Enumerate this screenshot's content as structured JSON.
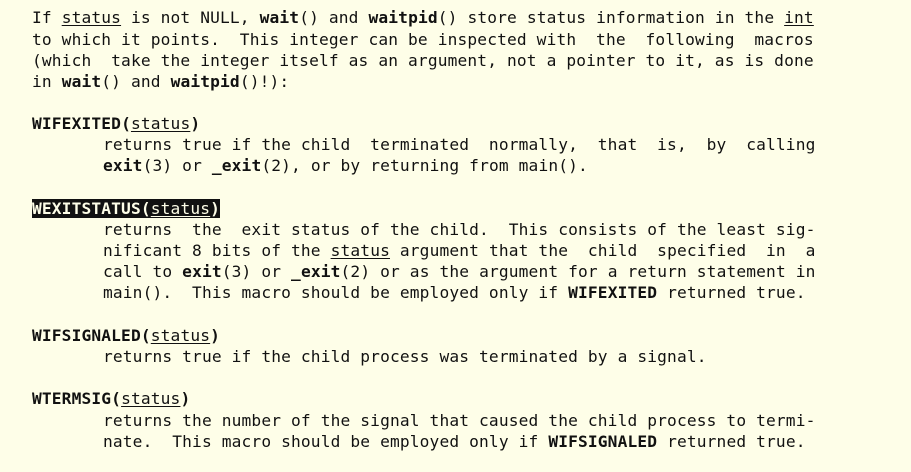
{
  "intro": {
    "l1": {
      "a": "If ",
      "status": "status",
      "b": " is not NULL, ",
      "wait": "wait",
      "c": "() and ",
      "waitpid": "waitpid",
      "d": "() store status information in the ",
      "int": "int"
    },
    "l2": "to which it points.  This integer can be inspected with  the  following  macros",
    "l3": "(which  take the integer itself as an argument, not a pointer to it, as is done",
    "l4": {
      "a": "in ",
      "wait": "wait",
      "b": "() and ",
      "waitpid": "waitpid",
      "c": "()!):"
    }
  },
  "wifexited": {
    "name": "WIFEXITED",
    "open": "(",
    "arg": "status",
    "close": ")",
    "d1": "returns true if the child  terminated  normally,  that  is,  by  calling",
    "d2": {
      "exit": "exit",
      "a": "(3) or ",
      "_exit": "_exit",
      "b": "(2), or by returning from main()."
    }
  },
  "wexitstatus": {
    "name": "WEXITSTATUS",
    "open": "(",
    "arg": "status",
    "close": ")",
    "d1": "returns  the  exit status of the child.  This consists of the least sig-",
    "d2": {
      "a": "nificant 8 bits of the ",
      "status": "status",
      "b": " argument that the  child  specified  in  a"
    },
    "d3": {
      "a": "call to ",
      "exit": "exit",
      "b": "(3) or ",
      "_exit": "_exit",
      "c": "(2) or as the argument for a return statement in"
    },
    "d4": {
      "a": "main().  This macro should be employed only if ",
      "wifexited": "WIFEXITED",
      "b": " returned true."
    }
  },
  "wifsignaled": {
    "name": "WIFSIGNALED",
    "open": "(",
    "arg": "status",
    "close": ")",
    "d1": "returns true if the child process was terminated by a signal."
  },
  "wtermsig": {
    "name": "WTERMSIG",
    "open": "(",
    "arg": "status",
    "close": ")",
    "d1": "returns the number of the signal that caused the child process to termi-",
    "d2": {
      "a": "nate.  This macro should be employed only if ",
      "wifsignaled": "WIFSIGNALED",
      "b": " returned true."
    }
  },
  "colors": {
    "background": "#fefee8",
    "text": "#111111",
    "highlight_bg": "#111111",
    "highlight_fg": "#fefee8"
  }
}
